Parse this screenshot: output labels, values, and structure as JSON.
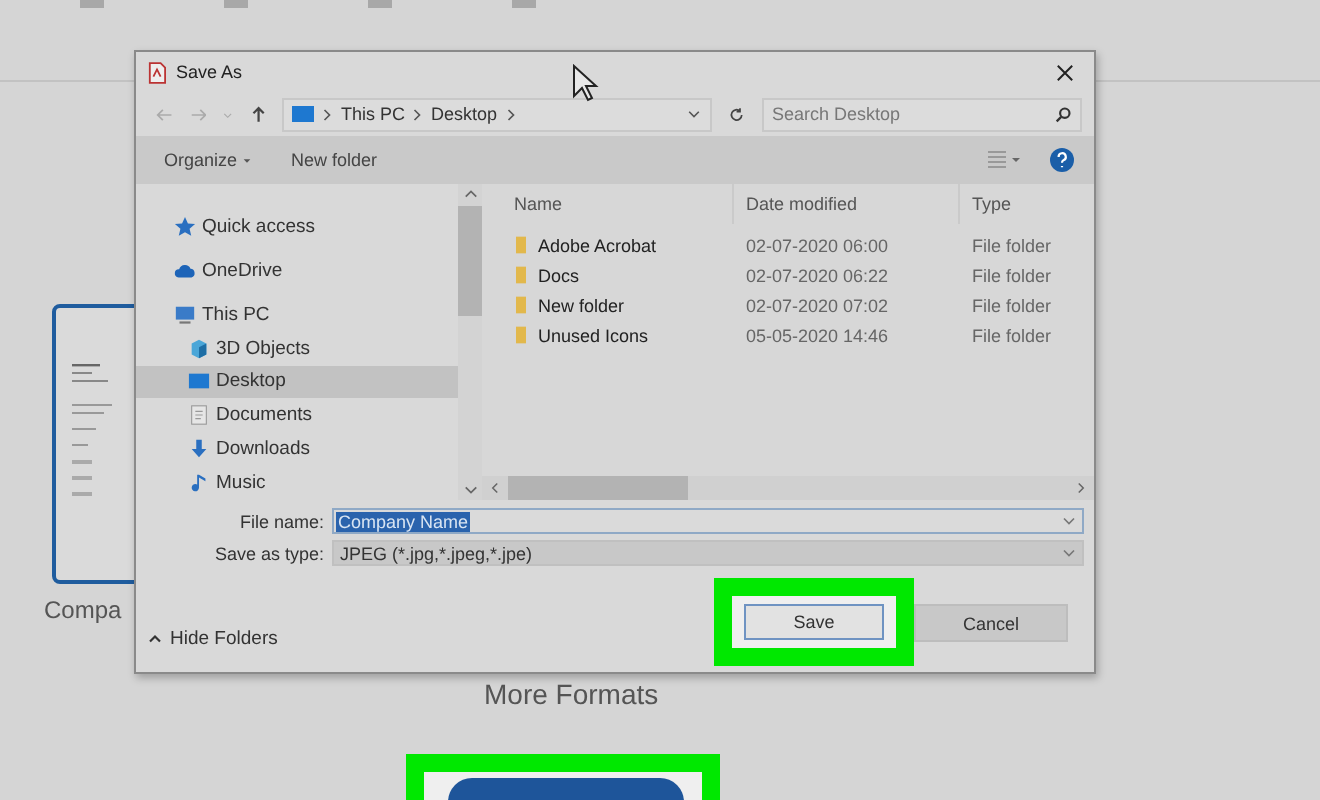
{
  "background_app": {
    "document_caption": "Compa",
    "more_formats": "More Formats",
    "action_button": {
      "highlighted": true
    }
  },
  "dialog": {
    "title": "Save As",
    "breadcrumb": [
      "This PC",
      "Desktop"
    ],
    "search": {
      "placeholder": "Search Desktop"
    },
    "commands": [
      "Organize",
      "New folder"
    ],
    "nav_items": [
      {
        "label": "Quick access",
        "kind": "star",
        "selected": false
      },
      {
        "label": "OneDrive",
        "kind": "cloud",
        "selected": false
      },
      {
        "label": "This PC",
        "kind": "pc",
        "selected": false,
        "children": [
          {
            "label": "3D Objects",
            "kind": "cube",
            "selected": false
          },
          {
            "label": "Desktop",
            "kind": "desktop",
            "selected": true
          },
          {
            "label": "Documents",
            "kind": "document",
            "selected": false
          },
          {
            "label": "Downloads",
            "kind": "download",
            "selected": false
          },
          {
            "label": "Music",
            "kind": "music",
            "selected": false
          }
        ]
      }
    ],
    "columns": [
      "Name",
      "Date modified",
      "Type"
    ],
    "rows": [
      {
        "name": "Adobe Acrobat",
        "date": "02-07-2020 06:00",
        "type": "File folder"
      },
      {
        "name": "Docs",
        "date": "02-07-2020 06:22",
        "type": "File folder"
      },
      {
        "name": "New folder",
        "date": "02-07-2020 07:02",
        "type": "File folder"
      },
      {
        "name": "Unused Icons",
        "date": "05-05-2020 14:46",
        "type": "File folder"
      }
    ],
    "file_name": {
      "label": "File name:",
      "value": "Company Name"
    },
    "save_as_type": {
      "label": "Save as type:",
      "value": "JPEG (*.jpg,*.jpeg,*.jpe)"
    },
    "hide_folders": "Hide Folders",
    "buttons": [
      {
        "label": "Save",
        "highlighted": true
      },
      {
        "label": "Cancel",
        "highlighted": false
      }
    ]
  }
}
